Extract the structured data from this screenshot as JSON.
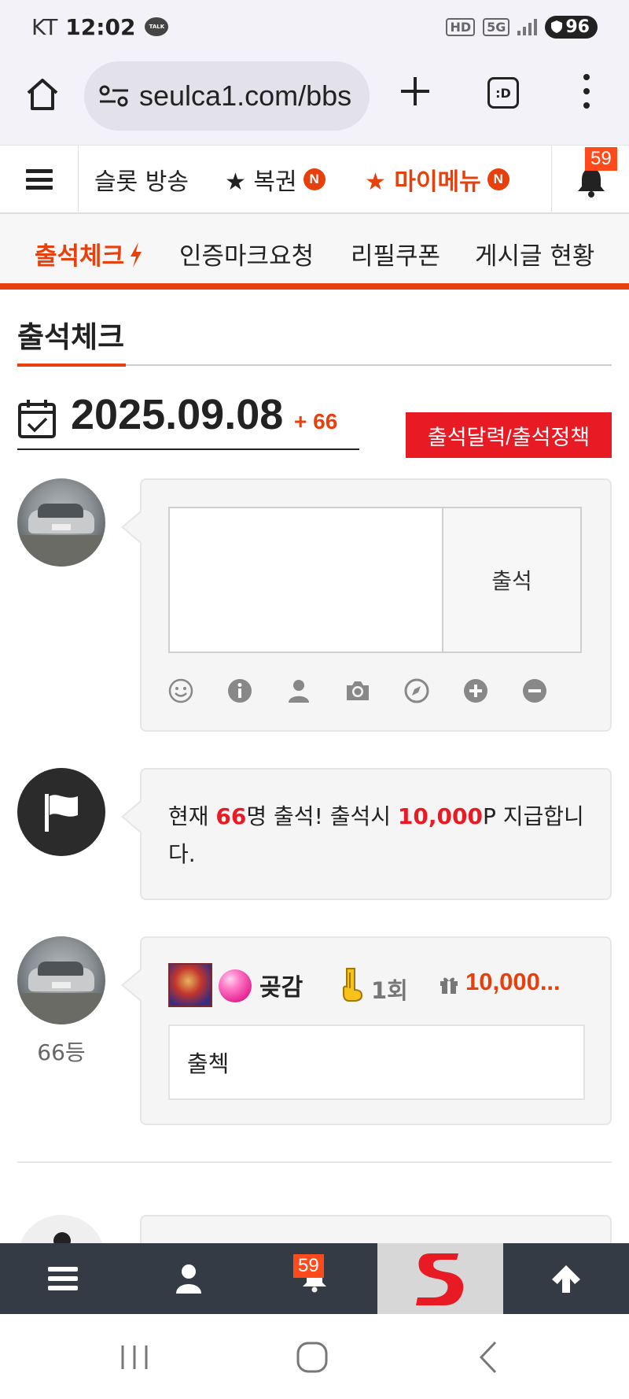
{
  "status_bar": {
    "carrier": "KT",
    "time": "12:02",
    "talk_badge": "TALK",
    "hd": "HD",
    "net": "5G",
    "battery": "96"
  },
  "browser": {
    "url": "seulca1.com/bbs",
    "tabs_label": ":D"
  },
  "site_nav": {
    "items": [
      {
        "label": "슬롯 방송"
      },
      {
        "label": "★ 복권",
        "badge": "N"
      },
      {
        "label": "★ 마이메뉴",
        "badge": "N",
        "color": "#e8400c"
      }
    ],
    "notification_count": "59"
  },
  "sub_nav": {
    "items": [
      "출석체크",
      "인증마크요청",
      "리필쿠폰",
      "게시글 현황"
    ],
    "active_index": 0
  },
  "page_title": "출석체크",
  "date_row": {
    "date": "2025.09.08",
    "delta": "+ 66"
  },
  "policy_button": "출석달력/출석정책",
  "attendance_form": {
    "textarea_value": "",
    "submit_label": "출석",
    "tools": [
      "smile-icon",
      "info-icon",
      "user-icon",
      "camera-icon",
      "compass-icon",
      "plus-circle-icon",
      "minus-circle-icon"
    ]
  },
  "notice": {
    "prefix": "현재 ",
    "count": "66",
    "middle": "명 출석! 출석시 ",
    "points": "10,000",
    "suffix": "P 지급합니다."
  },
  "entry": {
    "rank": "66등",
    "nickname": "곶감",
    "count": "1회",
    "points": "10,000...",
    "message": "출첵"
  },
  "bottom_bar": {
    "notification_count": "59"
  },
  "colors": {
    "accent": "#e8400c",
    "red_button": "#e81b24",
    "bottom_bar": "#343b44"
  }
}
